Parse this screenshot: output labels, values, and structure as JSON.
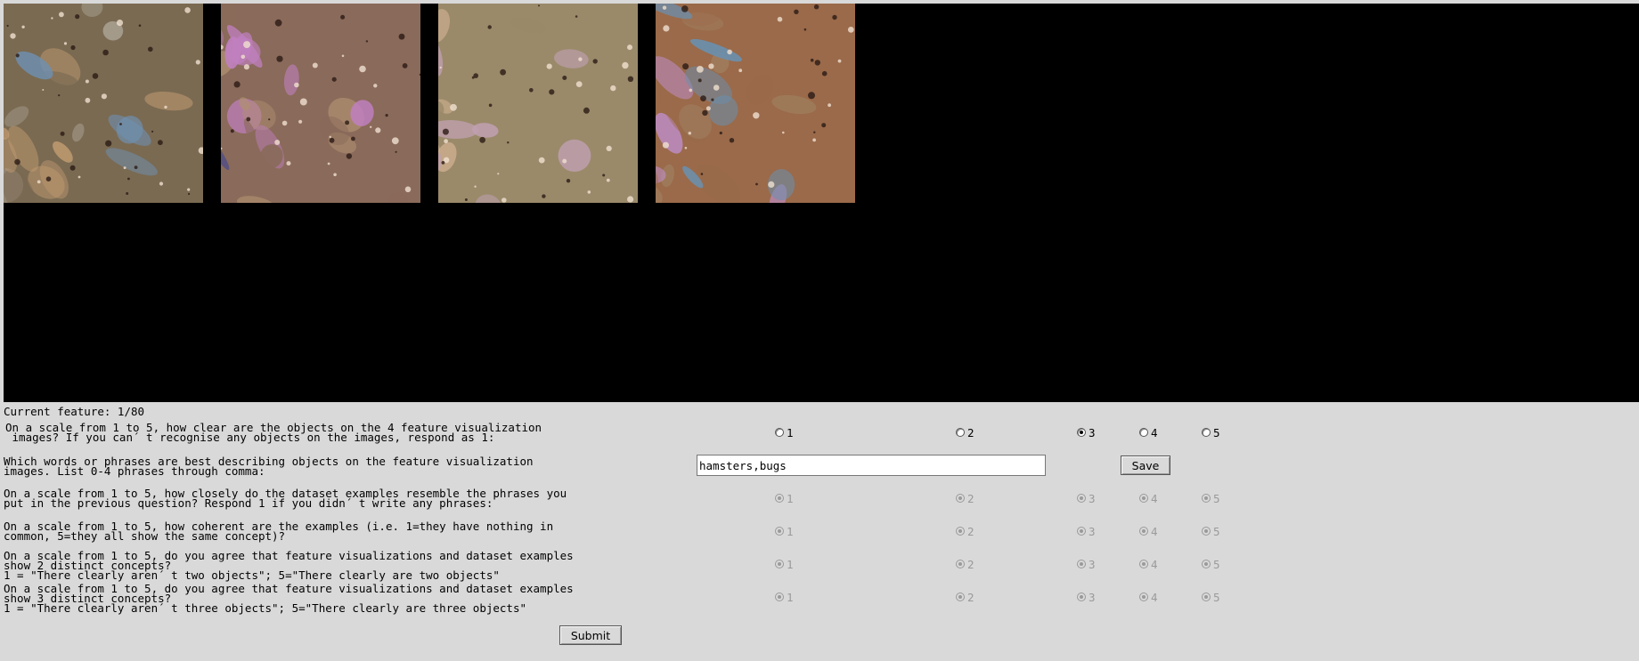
{
  "images": [
    {
      "name": "feature-visualization-1",
      "palette": [
        "#7a6a52",
        "#a8a090",
        "#6f8fb0",
        "#c09a70"
      ]
    },
    {
      "name": "feature-visualization-2",
      "palette": [
        "#8a6a5a",
        "#c080c0",
        "#4a4a8a",
        "#b09070"
      ]
    },
    {
      "name": "feature-visualization-3",
      "palette": [
        "#9a8a6a",
        "#c0a0b0",
        "#7a9a5a",
        "#d0b090"
      ]
    },
    {
      "name": "feature-visualization-4",
      "palette": [
        "#9a6a4a",
        "#c090d0",
        "#6a90b0",
        "#a08060"
      ]
    }
  ],
  "status": {
    "current_feature": "Current feature: 1/80"
  },
  "questions": [
    {
      "id": "clarity",
      "lines": [
        "On a scale from 1 to 5, how clear are the objects on the 4 feature visualization",
        " images? If you can´ t recognise any objects on the images, respond as 1:"
      ],
      "options": [
        "1",
        "2",
        "3",
        "4",
        "5"
      ],
      "selected": "3",
      "enabled": true
    },
    {
      "id": "phrases",
      "lines": [
        "Which words or phrases are best describing objects on the feature visualization",
        "images. List 0-4 phrases through comma:"
      ],
      "input_value": "hamsters,bugs",
      "input_placeholder": "",
      "save_label": "Save"
    },
    {
      "id": "resemblance",
      "lines": [
        "On a scale from 1 to 5, how closely do the dataset examples resemble the phrases you",
        "put in the previous question? Respond 1 if you didn´ t write any phrases:"
      ],
      "options": [
        "1",
        "2",
        "3",
        "4",
        "5"
      ],
      "enabled": false
    },
    {
      "id": "coherence",
      "lines": [
        "On a scale from 1 to 5, how coherent are the examples (i.e. 1=they have nothing in",
        "common, 5=they all show the same concept)?"
      ],
      "options": [
        "1",
        "2",
        "3",
        "4",
        "5"
      ],
      "enabled": false
    },
    {
      "id": "two-concepts",
      "lines": [
        "On a scale from 1 to 5, do you agree that feature visualizations and dataset examples",
        "show 2 distinct concepts?",
        "1 = \"There clearly aren´ t two objects\"; 5=\"There clearly are two objects\""
      ],
      "options": [
        "1",
        "2",
        "3",
        "4",
        "5"
      ],
      "enabled": false
    },
    {
      "id": "three-concepts",
      "lines": [
        "On a scale from 1 to 5, do you agree that feature visualizations and dataset examples",
        "show 3 distinct concepts?",
        "1 = \"There clearly aren´ t three objects\"; 5=\"There clearly are three objects\""
      ],
      "options": [
        "1",
        "2",
        "3",
        "4",
        "5"
      ],
      "enabled": false
    }
  ],
  "submit_label": "Submit"
}
